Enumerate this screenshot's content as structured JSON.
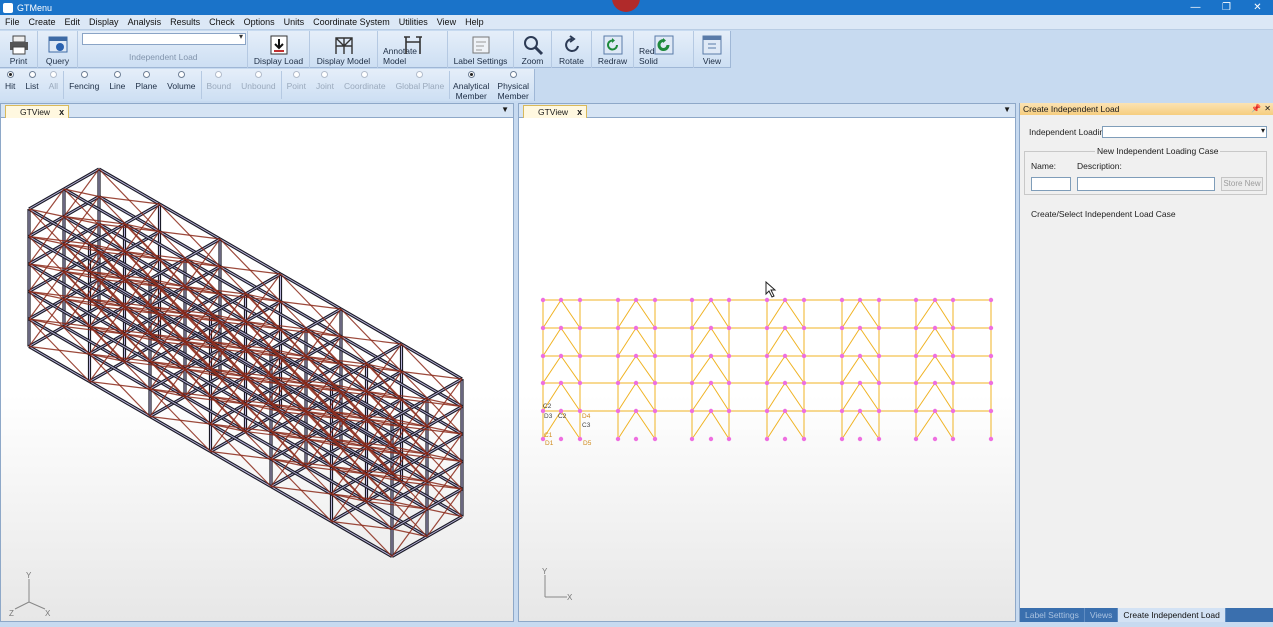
{
  "window": {
    "title": "GTMenu",
    "controls": [
      "—",
      "❐",
      "✕"
    ]
  },
  "menu": [
    "File",
    "Create",
    "Edit",
    "Display",
    "Analysis",
    "Results",
    "Check",
    "Options",
    "Units",
    "Coordinate System",
    "Utilities",
    "View",
    "Help"
  ],
  "toolbar": {
    "print": "Print",
    "query": "Query",
    "load_combo_value": "",
    "load_combo_label": "Independent Load",
    "display_load": "Display Load",
    "display_model": "Display Model",
    "annotate_model": "Annotate Model",
    "label_settings": "Label Settings",
    "zoom": "Zoom",
    "rotate": "Rotate",
    "redraw": "Redraw",
    "redraw_solid": "Redraw Solid",
    "view": "View"
  },
  "selection_modes": [
    {
      "label": "Hit",
      "checked": true,
      "enabled": true
    },
    {
      "label": "List",
      "checked": false,
      "enabled": true
    },
    {
      "label": "All",
      "checked": false,
      "enabled": false
    },
    {
      "label": "Fencing",
      "checked": false,
      "enabled": true
    },
    {
      "label": "Line",
      "checked": false,
      "enabled": true
    },
    {
      "label": "Plane",
      "checked": false,
      "enabled": true
    },
    {
      "label": "Volume",
      "checked": false,
      "enabled": true
    },
    {
      "label": "Bound",
      "checked": false,
      "enabled": false
    },
    {
      "label": "Unbound",
      "checked": false,
      "enabled": false
    },
    {
      "label": "Point",
      "checked": false,
      "enabled": false
    },
    {
      "label": "Joint",
      "checked": false,
      "enabled": false
    },
    {
      "label": "Coordinate",
      "checked": false,
      "enabled": false
    },
    {
      "label": "Global Plane",
      "checked": false,
      "enabled": false
    },
    {
      "label": "Analytical Member",
      "checked": true,
      "enabled": true
    },
    {
      "label": "Physical Member",
      "checked": false,
      "enabled": true
    }
  ],
  "left_view": {
    "tab": "GTView",
    "axes": {
      "y": "Y",
      "x": "X",
      "z": "Z"
    }
  },
  "right_view": {
    "tab": "GTView",
    "axes": {
      "y": "Y",
      "x": "X"
    },
    "node_labels": [
      "C2",
      "D3",
      "C2",
      "D4",
      "C3",
      "C1",
      "D1",
      "D5"
    ]
  },
  "dock": {
    "title": "Create Independent Load",
    "independent_loading_label": "Independent Loading",
    "independent_loading_value": "",
    "group_title": "New Independent Loading Case",
    "name_label": "Name:",
    "description_label": "Description:",
    "name_value": "",
    "description_value": "",
    "store_button": "Store New",
    "status_text": "Create/Select Independent Load Case",
    "bottom_tabs": [
      "Label Settings",
      "Views",
      "Create Independent Load"
    ]
  },
  "colors": {
    "accent": "#1a73c9",
    "frame_yellow": "#f0b323",
    "node_pink": "#ee6fe0",
    "steel_red": "#8b2a1a"
  }
}
